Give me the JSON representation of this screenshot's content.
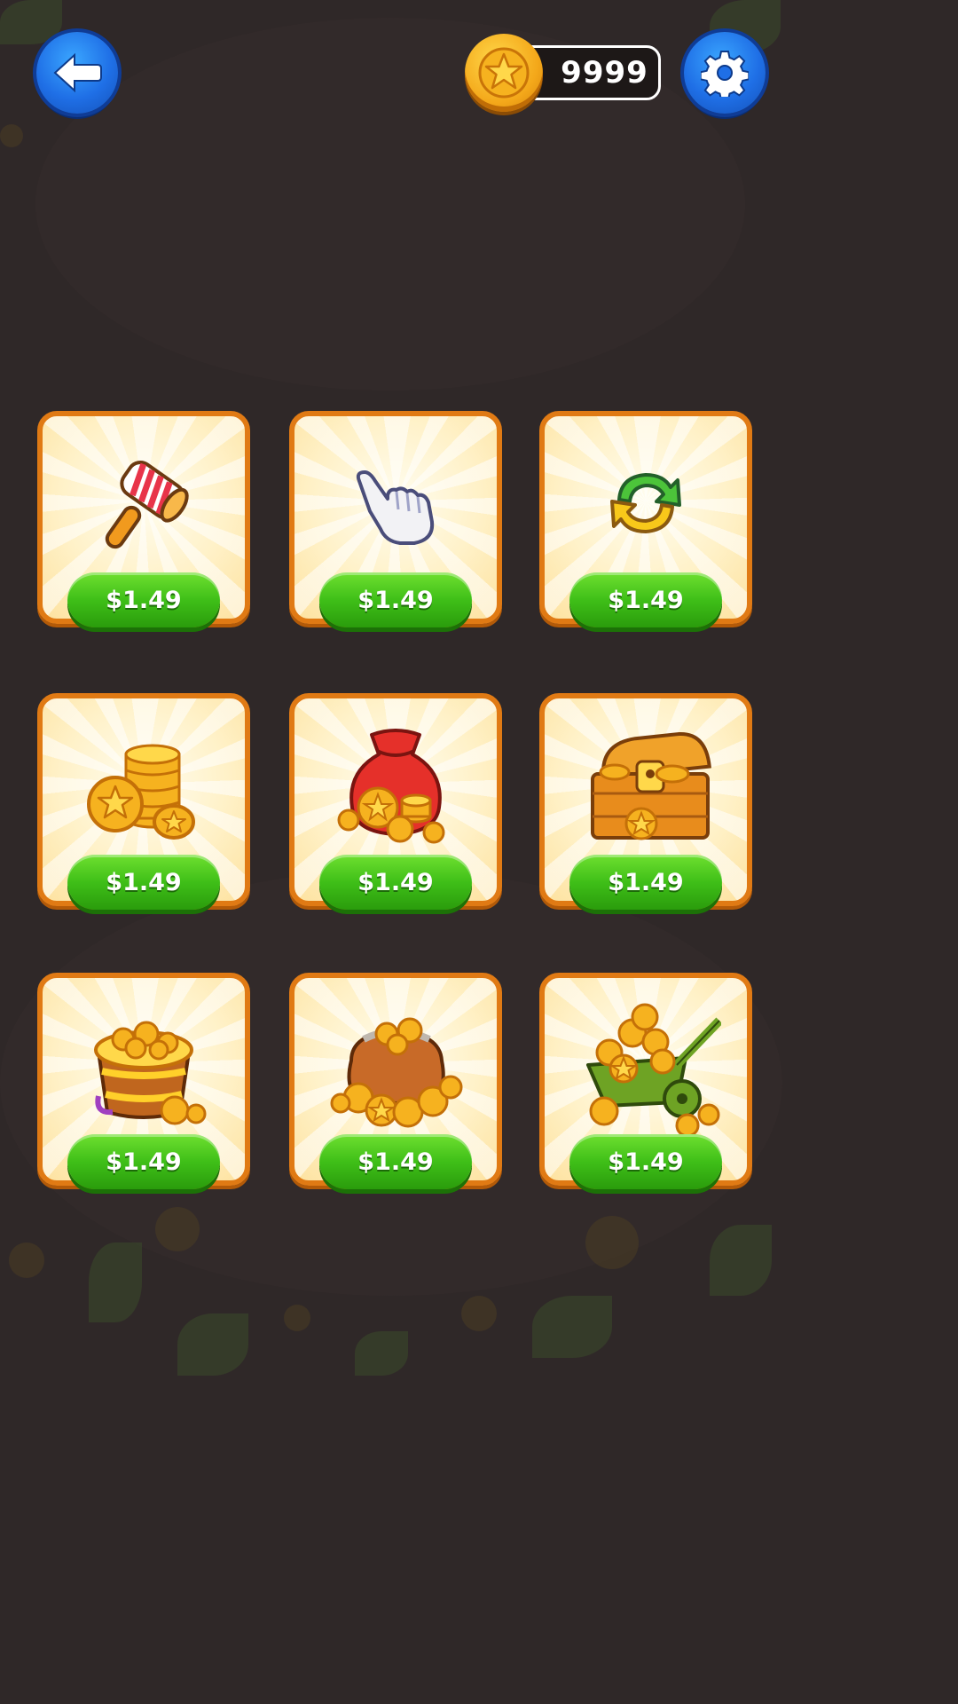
{
  "header": {
    "back_icon": "back-arrow-icon",
    "settings_icon": "gear-icon",
    "coin_icon": "star-coin-icon",
    "coin_balance": "9999"
  },
  "shop": {
    "items": [
      {
        "icon": "hammer-icon",
        "price": "$1.49"
      },
      {
        "icon": "glove-hand-icon",
        "price": "$1.49"
      },
      {
        "icon": "shuffle-arrows-icon",
        "price": "$1.49"
      },
      {
        "icon": "coin-stack-icon",
        "price": "$1.49"
      },
      {
        "icon": "coin-sack-icon",
        "price": "$1.49"
      },
      {
        "icon": "treasure-chest-icon",
        "price": "$1.49"
      },
      {
        "icon": "coin-bucket-icon",
        "price": "$1.49"
      },
      {
        "icon": "coin-bag-icon",
        "price": "$1.49"
      },
      {
        "icon": "coin-cart-icon",
        "price": "$1.49"
      }
    ]
  },
  "colors": {
    "background": "#2f2828",
    "card_border": "#e07a14",
    "price_button": "#3fbf18",
    "round_button": "#1f6fe6",
    "coin": "#f4a81a"
  }
}
